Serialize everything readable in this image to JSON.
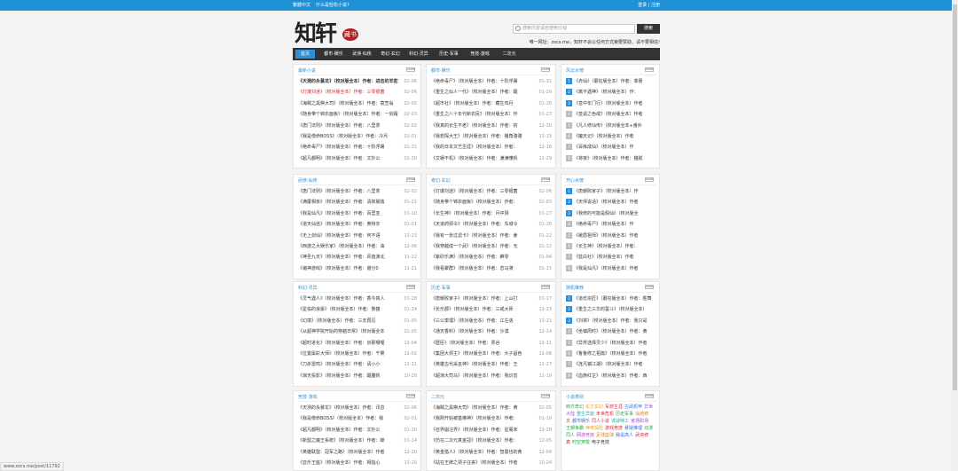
{
  "topbar": {
    "left": "繁體中文",
    "left2": "什么是轻松小说?",
    "right": "登录 | 注册"
  },
  "logo": {
    "text": "知轩",
    "seal": "藏书"
  },
  "search": {
    "placeholder": "搜索内容请自使用分钱",
    "button": "搜索",
    "notice": "唯一网址：zxcs.me，知轩不会以任何方式索要赞助，请不要相信!"
  },
  "nav": [
    "首页",
    "都市·娱乐",
    "武侠·仙侠",
    "奇幻·玄幻",
    "科幻·灵异",
    "历史·军事",
    "竞技·游戏",
    "二次元"
  ],
  "panels": [
    {
      "title": "最新小说",
      "rows": [
        [
          "《天测的永暴龙》（校对版全本）作者：进击的羊驼",
          "02-06",
          "bold"
        ],
        [
          "《灯爆刘迷》（校对版全本）作者：三零银菌",
          "02-06",
          "red"
        ],
        [
          "《海贼之黑棋大司》（校对版全本）作者：蓑笠翁",
          "02-05",
          ""
        ],
        [
          "《随身带个锦衣面板》（校对版全本）作者：一剑霜寒",
          "02-03",
          ""
        ],
        [
          "《唐门法则》（校对版全本）作者：八里茶",
          "02-02",
          ""
        ],
        [
          "《我是傍命BOSS》（校对版全本）作者：冷月",
          "02-01",
          ""
        ],
        [
          "《绝命毒尸》（校对版全本）作者：十阶浮屠",
          "01-31",
          ""
        ],
        [
          "《超凡都明》（校对版全本）作者：文抄公",
          "01-30",
          ""
        ]
      ]
    },
    {
      "title": "都市·娱乐",
      "rows": [
        [
          "《绝命毒尸》（校对版全本）作者：十阶浮屠",
          "01-31",
          ""
        ],
        [
          "《重生之似人一代》（校对版全本）作者：醒",
          "01-29",
          ""
        ],
        [
          "《超市社》（校对版全本）作者：藏生鸡月",
          "01-26",
          ""
        ],
        [
          "《重生之八十年代新农民》（校对版全本）作",
          "01-23",
          ""
        ],
        [
          "《我真的长生不老》（校对版全本）作者：初",
          "12-30",
          ""
        ],
        [
          "《我想探大王》（校对版全本）作者：猪角骆骆",
          "12-15",
          ""
        ],
        [
          "《我的日本文艺生涯》（校对版全本）作者：",
          "12-16",
          ""
        ],
        [
          "《文娱不机》（校对版全本）作者：满满懂帆",
          "11-29",
          ""
        ]
      ]
    },
    {
      "title": "武侠·仙侠",
      "rows": [
        [
          "《唐门法则》（校对版全本）作者：八里茶",
          "02-02",
          ""
        ],
        [
          "《满厦相亲》（校对版全本）作者：清抹晨烛",
          "01-21",
          ""
        ],
        [
          "《我是仙凡》（校对版全本）作者：百里亚",
          "01-10",
          ""
        ],
        [
          "《道天仙途》（校对版全本）作者：奥特亦",
          "01-01",
          ""
        ],
        [
          "《无上剑仙》（校对版全本）作者：何不语",
          "12-23",
          ""
        ],
        [
          "《西游之大娱乐家》（校对版全本）作者：油",
          "12-06",
          ""
        ],
        [
          "《神圣九天》（校对版全本）作者：风值渊北",
          "11-22",
          ""
        ],
        [
          "《诸神游戏》（校对版全本）作者：谢分0",
          "11-21",
          ""
        ]
      ]
    },
    {
      "title": "奇幻·玄幻",
      "rows": [
        [
          "《灯爆刘迷》（校对版全本）作者：三零银菌",
          "02-06",
          ""
        ],
        [
          "《随身带个锦衣面板》（校对版全本）作者：",
          "02-03",
          ""
        ],
        [
          "《长生神》（校对版全本）作者：月中阴",
          "01-27",
          ""
        ],
        [
          "《天道药邪令》（校对版全本）作者：东城令",
          "01-26",
          ""
        ],
        [
          "《我有一张过滤卡》（校对版全本）作者：姜",
          "01-22",
          ""
        ],
        [
          "《我穿越成一个武》（校对版全本）作者：无",
          "01-12",
          ""
        ],
        [
          "《紫砂乐满》（校对版全本）作者：麒零",
          "01-04",
          ""
        ],
        [
          "《我看聚群》（校对版全本）作者：恋马骑",
          "01-15",
          ""
        ]
      ]
    },
    {
      "title": "科幻·灵异",
      "rows": [
        [
          "《灵气遇人》（校对版全本）作者：香今真人",
          "01-28",
          ""
        ],
        [
          "《星佑的浪豪》（校对版全本）作者：熊猫",
          "01-24",
          ""
        ],
        [
          "《幻境》（校对版全本）作者：三天再见",
          "01-05",
          ""
        ],
        [
          "《从超神学院开始的穿越日常》（校对版全本",
          "01-05",
          ""
        ],
        [
          "《超时进化》（校对版全本）作者：京那哪哩",
          "12-04",
          ""
        ],
        [
          "《位置属彩大师》（校对版全本）作者：千雾",
          "12-02",
          ""
        ],
        [
          "《刀杀雷鸣》（校对版全本）作者：请小小",
          "11-11",
          ""
        ],
        [
          "《演天投影》（校对版全本）作者：醒腹帆",
          "10-28",
          ""
        ]
      ]
    },
    {
      "title": "历史·军事",
      "rows": [
        [
          "《唐朝败家子》（校对版全本）作者：上山打",
          "01-17",
          ""
        ],
        [
          "《长乐郡》（校对版全本）作者：三戒大师",
          "12-23",
          ""
        ],
        [
          "《三公季理》（校对版全本）作者：江左洛",
          "12-21",
          ""
        ],
        [
          "《通天香料》（校对版全本）作者：沙漠",
          "12-14",
          ""
        ],
        [
          "《歷臣》（校对版全本）作者：贾谷",
          "12-11",
          ""
        ],
        [
          "《集团大领主》（校对版全本）作者：大子昌色",
          "12-08",
          ""
        ],
        [
          "《英雄古代采巫神》（校对版全本）作者：王",
          "11-27",
          ""
        ],
        [
          "《超演大司马》（校对版全本）作者：我识音",
          "11-19",
          ""
        ]
      ]
    },
    {
      "title": "竞技·游戏",
      "rows": [
        [
          "《天测的永暴龙》（校对版全本）作者：讯息",
          "02-06",
          ""
        ],
        [
          "《我是傍命BOSS》（校对版全本）作者：我",
          "02-01",
          ""
        ],
        [
          "《超凡都明》（校对版全本）作者：文抄公",
          "01-30",
          ""
        ],
        [
          "《新盟之魔王系统》（校对版全本）作者：蝉",
          "01-14",
          ""
        ],
        [
          "《英雄联盟：冠军之路》（校对版全本）作者",
          "12-20",
          ""
        ],
        [
          "《亚乐王座》（校对版全本）作者：拇指心",
          "12-29",
          ""
        ]
      ]
    },
    {
      "title": "二次元",
      "rows": [
        [
          "《海贼之黑棋大司》（校对版全本）作者：黄",
          "02-05",
          ""
        ],
        [
          "《我刚开始被基佛神》（校对版全本）作者：",
          "01-19",
          ""
        ],
        [
          "《召界崩注界》（校对版全本）作者：星阁未",
          "12-28",
          ""
        ],
        [
          "《仍在二次元真金冠》（校对版全本）作者：",
          "12-05",
          ""
        ],
        [
          "《黄金猎人》（校对版全本）作者：智置也的黄",
          "12-04",
          ""
        ],
        [
          "《站在王牌之领子往来》（校对版全本）作者",
          "10-24",
          ""
        ]
      ]
    }
  ],
  "side_panels": [
    {
      "title": "风云水榜",
      "rows": [
        "《赤仙》（蘑挖版全本）作者：菲惠",
        "《离不遇神》（校对版全本）作：",
        "《皇中年门行》（校对版全本）作者",
        "《皇逼之色戒》（校对版全本）作者",
        "《凡人修仙传》（校对版全本+番外",
        "《魔天记》（校对版全本）作者",
        "《百练成仙》（校对版全本）作",
        "《将夜》（校对版全本）作者：猫腻"
      ]
    },
    {
      "title": "开心水榜",
      "rows": [
        "《唐朝败家子》（校对版全本）作",
        "《天师说话》（校对版全本）作者",
        "《我修的可能是假仙》（校对版全",
        "《绝命毒尸》（校对版全本）作",
        "《峨眉祖师》（校对版全本）作者",
        "《长生神》（校对版全本）作者：",
        "《蓝白社》（校对版全本）作者",
        "《我是仙凡》（校对版全本）作者"
      ]
    },
    {
      "title": "随机推荐",
      "rows": [
        "《道氏宗匠》（蘑挖版全本）作者：胜舞",
        "《重生之三华的誓斗》（校对版全本）",
        "《刘将》（校对版全本）作者：我只是",
        "《坐镇周时》（校对版全本）作者：黄",
        "《异界选择灵少》（校对版全本）作者",
        "《鲁鲁修之祖篇》（校对版全本）作者",
        "《连凡镇江湖》（校对版全本）作者",
        "《血族红芷》（校对版全本）作者：西"
      ]
    }
  ],
  "tags_panel": {
    "title": "小说类别",
    "tags": [
      {
        "t": "西方奇幻",
        "c": "#2aa84a"
      },
      {
        "t": "东方玄幻",
        "c": "#e0a020"
      },
      {
        "t": "军旅生涯",
        "c": "#d2324a"
      },
      {
        "t": "古武机甲",
        "c": "#2d6fd8"
      },
      {
        "t": "异世大陆",
        "c": "#b04ad8"
      },
      {
        "t": "重生异能",
        "c": "#2aa8a0"
      },
      {
        "t": "末世危机",
        "c": "#d23"
      },
      {
        "t": "历史军事",
        "c": "#2aa84a"
      },
      {
        "t": "仙侠修真",
        "c": "#e08020"
      },
      {
        "t": "都市娱乐",
        "c": "#2d6fd8"
      },
      {
        "t": "同人小说",
        "c": "#d2324a"
      },
      {
        "t": "谍战特工",
        "c": "#2aa8a0"
      },
      {
        "t": "官场职场",
        "c": "#b04ad8"
      },
      {
        "t": "王朝争霸",
        "c": "#2aa84a"
      },
      {
        "t": "神奇探险",
        "c": "#e0a020"
      },
      {
        "t": "游戏竞技",
        "c": "#d23"
      },
      {
        "t": "悬疑推理",
        "c": "#2d6fd8"
      },
      {
        "t": "动漫同人",
        "c": "#2aa84a"
      },
      {
        "t": "网游竞技",
        "c": "#b04ad8"
      },
      {
        "t": "足球篮球",
        "c": "#e08020"
      },
      {
        "t": "我是高人",
        "c": "#2d6fd8"
      },
      {
        "t": "武侠修真",
        "c": "#d23"
      },
      {
        "t": "时空穿梭",
        "c": "#2aa84a"
      },
      {
        "t": "电子竞技",
        "c": "#333"
      }
    ]
  },
  "status_url": "www.zxcs.me/post/11792"
}
